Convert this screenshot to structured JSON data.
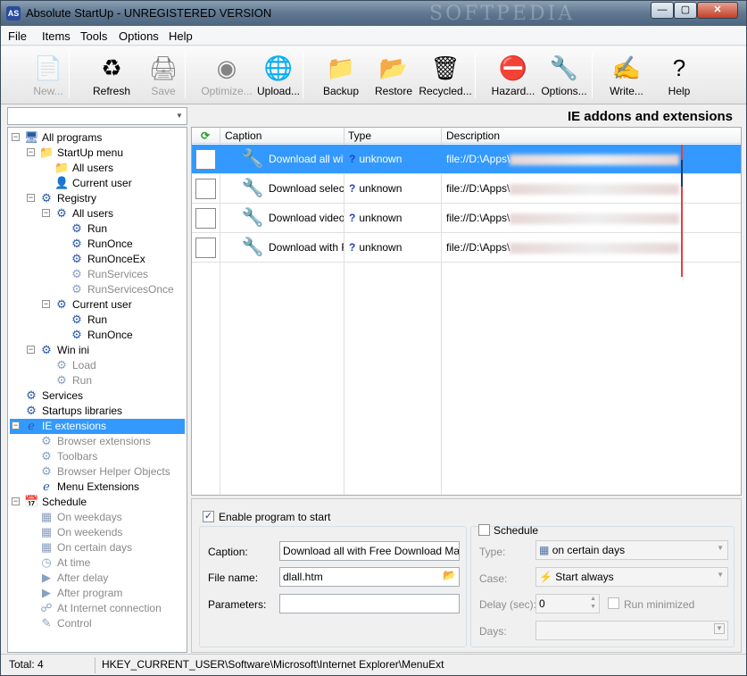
{
  "window": {
    "title": "Absolute StartUp - UNREGISTERED VERSION",
    "watermark": "SOFTPEDIA",
    "min": "—",
    "max": "▢",
    "close": "✕"
  },
  "menu": [
    "File",
    "Items",
    "Tools",
    "Options",
    "Help"
  ],
  "toolbar": [
    {
      "label": "New...",
      "icon": "📄",
      "name": "new-button",
      "disabled": true
    },
    {
      "label": "Refresh",
      "icon": "♻",
      "name": "refresh-button",
      "disabled": false
    },
    {
      "label": "Save",
      "icon": "🖨",
      "name": "save-button",
      "disabled": true
    },
    {
      "label": "Optimize...",
      "icon": "◉",
      "name": "optimize-button",
      "disabled": true
    },
    {
      "label": "Upload...",
      "icon": "🌐",
      "name": "upload-button",
      "disabled": false
    },
    {
      "label": "Backup",
      "icon": "📁",
      "name": "backup-button",
      "disabled": false
    },
    {
      "label": "Restore",
      "icon": "📂",
      "name": "restore-button",
      "disabled": false
    },
    {
      "label": "Recycled...",
      "icon": "🗑",
      "name": "recycled-button",
      "disabled": false
    },
    {
      "label": "Hazard...",
      "icon": "⛔",
      "name": "hazard-button",
      "disabled": false
    },
    {
      "label": "Options...",
      "icon": "🔧",
      "name": "options-button",
      "disabled": false
    },
    {
      "label": "Write...",
      "icon": "✍",
      "name": "write-button",
      "disabled": false
    },
    {
      "label": "Help",
      "icon": "?",
      "name": "help-button",
      "disabled": false
    }
  ],
  "tree": [
    {
      "label": "All programs",
      "level": 0,
      "toggle": "−",
      "icon": "🖥",
      "dim": false
    },
    {
      "label": "StartUp menu",
      "level": 1,
      "toggle": "−",
      "icon": "📁",
      "dim": false
    },
    {
      "label": "All users",
      "level": 2,
      "toggle": "",
      "icon": "📁",
      "dim": false
    },
    {
      "label": "Current user",
      "level": 2,
      "toggle": "",
      "icon": "👤",
      "dim": false
    },
    {
      "label": "Registry",
      "level": 1,
      "toggle": "−",
      "icon": "⚙",
      "dim": false
    },
    {
      "label": "All users",
      "level": 2,
      "toggle": "−",
      "icon": "⚙",
      "dim": false
    },
    {
      "label": "Run",
      "level": 3,
      "toggle": "",
      "icon": "⚙",
      "dim": false
    },
    {
      "label": "RunOnce",
      "level": 3,
      "toggle": "",
      "icon": "⚙",
      "dim": false
    },
    {
      "label": "RunOnceEx",
      "level": 3,
      "toggle": "",
      "icon": "⚙",
      "dim": false
    },
    {
      "label": "RunServices",
      "level": 3,
      "toggle": "",
      "icon": "⚙",
      "dim": true
    },
    {
      "label": "RunServicesOnce",
      "level": 3,
      "toggle": "",
      "icon": "⚙",
      "dim": true
    },
    {
      "label": "Current user",
      "level": 2,
      "toggle": "−",
      "icon": "⚙",
      "dim": false
    },
    {
      "label": "Run",
      "level": 3,
      "toggle": "",
      "icon": "⚙",
      "dim": false
    },
    {
      "label": "RunOnce",
      "level": 3,
      "toggle": "",
      "icon": "⚙",
      "dim": false
    },
    {
      "label": "Win ini",
      "level": 1,
      "toggle": "−",
      "icon": "⚙",
      "dim": false
    },
    {
      "label": "Load",
      "level": 2,
      "toggle": "",
      "icon": "⚙",
      "dim": true
    },
    {
      "label": "Run",
      "level": 2,
      "toggle": "",
      "icon": "⚙",
      "dim": true
    },
    {
      "label": "Services",
      "level": 0,
      "toggle": "",
      "icon": "⚙",
      "dim": false
    },
    {
      "label": "Startups libraries",
      "level": 0,
      "toggle": "",
      "icon": "⚙",
      "dim": false
    },
    {
      "label": "IE extensions",
      "level": 0,
      "toggle": "−",
      "icon": "ℯ",
      "dim": false,
      "selected": true
    },
    {
      "label": "Browser extensions",
      "level": 1,
      "toggle": "",
      "icon": "⚙",
      "dim": true
    },
    {
      "label": "Toolbars",
      "level": 1,
      "toggle": "",
      "icon": "⚙",
      "dim": true
    },
    {
      "label": "Browser Helper Objects",
      "level": 1,
      "toggle": "",
      "icon": "⚙",
      "dim": true
    },
    {
      "label": "Menu Extensions",
      "level": 1,
      "toggle": "",
      "icon": "ℯ",
      "dim": false
    },
    {
      "label": "Schedule",
      "level": 0,
      "toggle": "−",
      "icon": "📅",
      "dim": false
    },
    {
      "label": "On weekdays",
      "level": 1,
      "toggle": "",
      "icon": "▦",
      "dim": true
    },
    {
      "label": "On weekends",
      "level": 1,
      "toggle": "",
      "icon": "▦",
      "dim": true
    },
    {
      "label": "On certain days",
      "level": 1,
      "toggle": "",
      "icon": "▦",
      "dim": true
    },
    {
      "label": "At time",
      "level": 1,
      "toggle": "",
      "icon": "◷",
      "dim": true
    },
    {
      "label": "After delay",
      "level": 1,
      "toggle": "",
      "icon": "▶",
      "dim": true
    },
    {
      "label": "After program",
      "level": 1,
      "toggle": "",
      "icon": "▶",
      "dim": true
    },
    {
      "label": "At Internet connection",
      "level": 1,
      "toggle": "",
      "icon": "☍",
      "dim": true
    },
    {
      "label": "Control",
      "level": 1,
      "toggle": "",
      "icon": "✎",
      "dim": true
    }
  ],
  "panel": {
    "title": "IE addons and extensions",
    "columns": {
      "caption": "Caption",
      "type": "Type",
      "description": "Description"
    },
    "rows": [
      {
        "caption": "Download all with Free Download Manager",
        "type": "unknown",
        "desc": "file://D:\\Apps\\",
        "selected": true
      },
      {
        "caption": "Download selected with Free Download Manager",
        "type": "unknown",
        "desc": "file://D:\\Apps\\",
        "selected": false
      },
      {
        "caption": "Download video with Free Download Manager",
        "type": "unknown",
        "desc": "file://D:\\Apps\\",
        "selected": false
      },
      {
        "caption": "Download with Free Download Manager",
        "type": "unknown",
        "desc": "file://D:\\Apps\\",
        "selected": false
      }
    ]
  },
  "props": {
    "enable_label": "Enable program to start",
    "enable_check": "✓",
    "caption_label": "Caption:",
    "caption_value": "Download all with Free Download Manag",
    "filename_label": "File name:",
    "filename_value": "dlall.htm",
    "params_label": "Parameters:",
    "params_value": "",
    "schedule_label": "Schedule",
    "type_label": "Type:",
    "type_value": "on certain days",
    "case_label": "Case:",
    "case_value": "Start always",
    "delay_label": "Delay (sec):",
    "delay_value": "0",
    "run_minimized_label": "Run minimized",
    "days_label": "Days:",
    "days_value": ""
  },
  "status": {
    "total": "Total: 4",
    "path": "HKEY_CURRENT_USER\\Software\\Microsoft\\Internet Explorer\\MenuExt"
  }
}
